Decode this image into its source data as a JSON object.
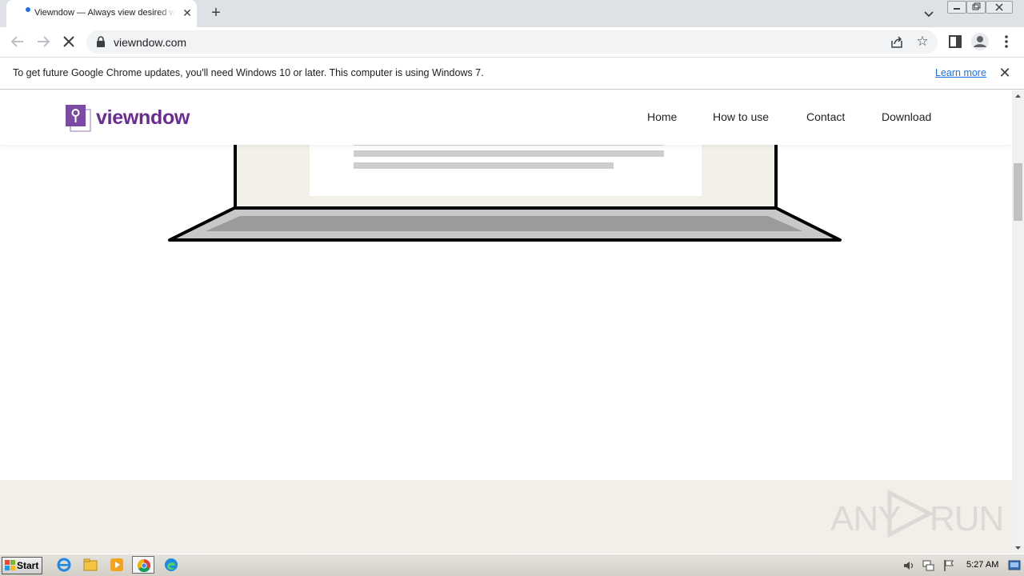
{
  "browser": {
    "tab": {
      "title": "Viewndow — Always view desired windows"
    },
    "url": "viewndow.com",
    "infobar": {
      "message": "To get future Google Chrome updates, you'll need Windows 10 or later. This computer is using Windows 7.",
      "link": "Learn more"
    }
  },
  "site": {
    "logo_text": "viewndow",
    "nav": [
      {
        "label": "Home"
      },
      {
        "label": "How to use"
      },
      {
        "label": "Contact"
      },
      {
        "label": "Download"
      }
    ],
    "brand_color": "#6a2c91"
  },
  "watermark": {
    "left": "ANY",
    "right": "RUN"
  },
  "taskbar": {
    "start_label": "Start",
    "apps": [
      "ie-icon",
      "explorer-icon",
      "media-player-icon",
      "chrome-icon",
      "edge-icon"
    ],
    "clock": "5:27 AM"
  }
}
